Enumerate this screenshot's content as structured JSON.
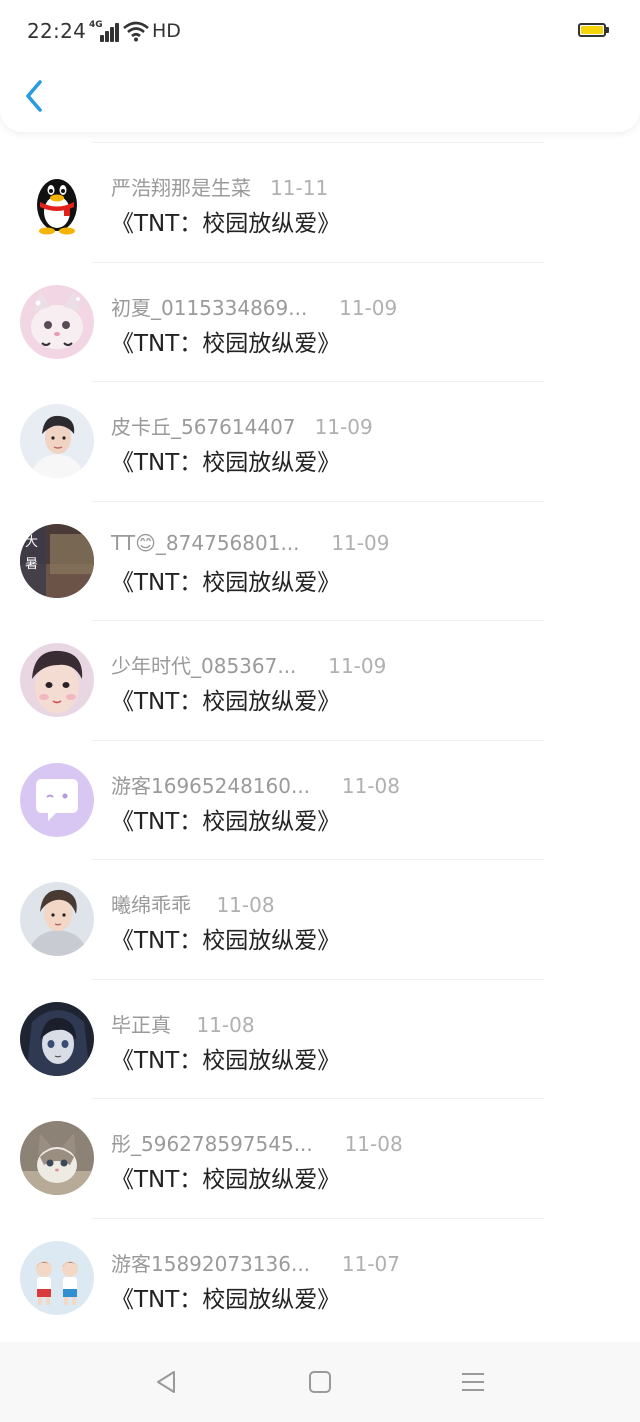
{
  "status_bar": {
    "time": "22:24",
    "network": "4G",
    "hd_label": "HD",
    "battery_color": "#f5d40c"
  },
  "header": {
    "back_icon": "chevron-left-icon",
    "accent_color": "#2a9be0"
  },
  "items": [
    {
      "name": "严浩翔那是生菜",
      "date": "11-11",
      "title": "《TNT：校园放纵爱》",
      "avatar": "qq-penguin"
    },
    {
      "name": "初夏_0115334869...",
      "date": "11-09",
      "title": "《TNT：校园放纵爱》",
      "avatar": "pink-cat"
    },
    {
      "name": "皮卡丘_567614407",
      "date": "11-09",
      "title": "《TNT：校园放纵爱》",
      "avatar": "boy-white"
    },
    {
      "name": "TT😊_874756801...",
      "date": "11-09",
      "title": "《TNT：校园放纵爱》",
      "avatar": "dark-scene"
    },
    {
      "name": "少年时代_085367...",
      "date": "11-09",
      "title": "《TNT：校园放纵爱》",
      "avatar": "boy-pink"
    },
    {
      "name": "游客16965248160...",
      "date": "11-08",
      "title": "《TNT：校园放纵爱》",
      "avatar": "chat-bubble"
    },
    {
      "name": "曦绵乖乖",
      "date": "11-08",
      "title": "《TNT：校园放纵爱》",
      "avatar": "boy-gray"
    },
    {
      "name": "毕正真",
      "date": "11-08",
      "title": "《TNT：校园放纵爱》",
      "avatar": "anime-dark"
    },
    {
      "name": "彤_596278597545...",
      "date": "11-08",
      "title": "《TNT：校园放纵爱》",
      "avatar": "kitten"
    },
    {
      "name": "游客15892073136...",
      "date": "11-07",
      "title": "《TNT：校园放纵爱》",
      "avatar": "kids"
    }
  ],
  "nav": {
    "back": "triangle-back-icon",
    "home": "square-home-icon",
    "menu": "menu-lines-icon"
  }
}
